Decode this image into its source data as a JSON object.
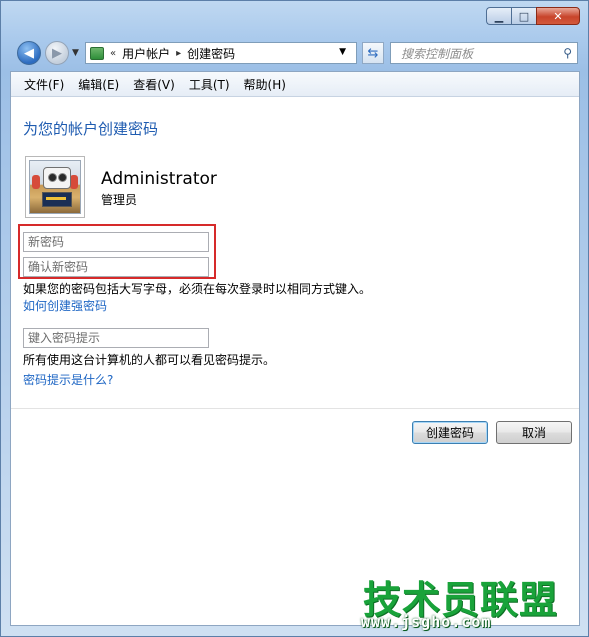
{
  "window": {
    "caption": {
      "minimize_glyph": "▁",
      "maximize_glyph": "□",
      "close_glyph": "✕"
    },
    "nav": {
      "back_icon": "back-arrow-icon",
      "forward_icon": "forward-arrow-icon",
      "breadcrumb": [
        "用户帐户",
        "创建密码"
      ],
      "breadcrumb_prefix": "«",
      "search_placeholder": "搜索控制面板"
    },
    "menu": [
      "文件(F)",
      "编辑(E)",
      "查看(V)",
      "工具(T)",
      "帮助(H)"
    ]
  },
  "main": {
    "title": "为您的帐户创建密码",
    "user": {
      "name": "Administrator",
      "role": "管理员"
    },
    "new_password_placeholder": "新密码",
    "confirm_password_placeholder": "确认新密码",
    "case_note": "如果您的密码包括大写字母，必须在每次登录时以相同方式键入。",
    "strong_password_link": "如何创建强密码",
    "hint_placeholder": "键入密码提示",
    "hint_note": "所有使用这台计算机的人都可以看见密码提示。",
    "hint_link": "密码提示是什么?",
    "create_button": "创建密码",
    "cancel_button": "取消"
  },
  "watermark": {
    "title": "技术员联盟",
    "url": "www.jsgho.com"
  },
  "colors": {
    "accent": "#1e5bb0",
    "link": "#1e66c4",
    "highlight": "#d62a2a",
    "watermark": "#19a33a"
  }
}
